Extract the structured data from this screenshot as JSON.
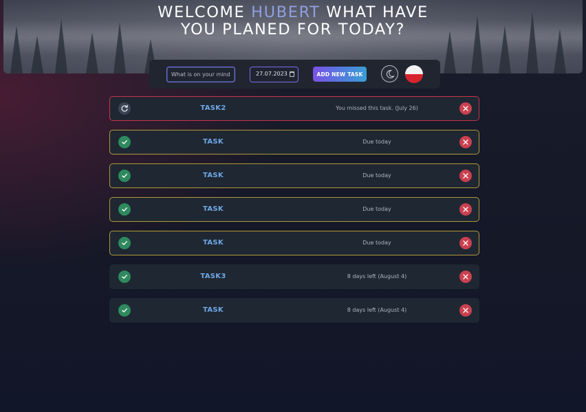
{
  "header": {
    "title_before": "WELCOME",
    "user_name": "HUBERT",
    "title_after": "WHAT HAVE YOU PLANED FOR TODAY?"
  },
  "controls": {
    "task_placeholder": "What is on your mind?",
    "date_value": "27.07.2023",
    "date_icon": "calendar-icon",
    "add_button_label": "ADD NEW TASK",
    "theme_icon": "moon-icon",
    "language_icon": "poland-flag-icon"
  },
  "colors": {
    "accent": "#7f6bea",
    "task_name": "#6fa8e6",
    "missed_border": "#c8344a",
    "today_border": "#b39a3a",
    "done_icon": "#2e8a5e",
    "delete_icon": "#c9404f"
  },
  "tasks": [
    {
      "name": "TASK2",
      "status": "You missed this task. (July 26)",
      "state": "missed",
      "lead_icon": "redo-icon"
    },
    {
      "name": "TASK",
      "status": "Due today",
      "state": "today",
      "lead_icon": "check-icon"
    },
    {
      "name": "TASK",
      "status": "Due today",
      "state": "today",
      "lead_icon": "check-icon"
    },
    {
      "name": "TASK",
      "status": "Due today",
      "state": "today",
      "lead_icon": "check-icon"
    },
    {
      "name": "TASK",
      "status": "Due today",
      "state": "today",
      "lead_icon": "check-icon"
    },
    {
      "name": "TASK3",
      "status": "8 days left (August 4)",
      "state": "later",
      "lead_icon": "check-icon"
    },
    {
      "name": "TASK",
      "status": "8 days left (August 4)",
      "state": "later",
      "lead_icon": "check-icon"
    }
  ]
}
